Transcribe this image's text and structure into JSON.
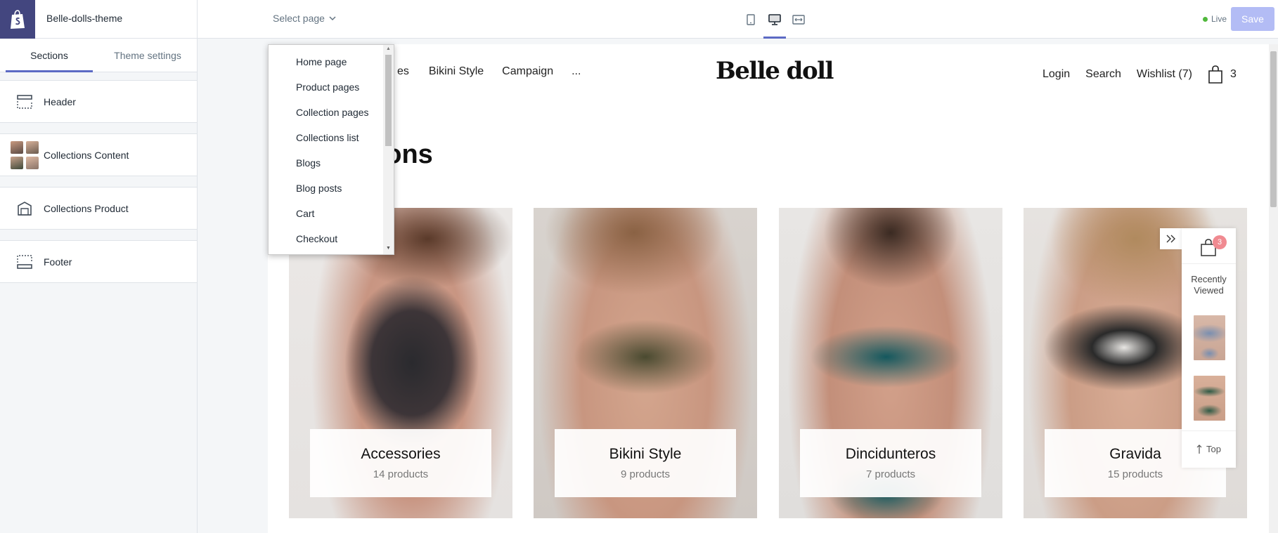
{
  "topbar": {
    "theme_name": "Belle-dolls-theme",
    "select_page_label": "Select page",
    "live_label": "Live",
    "save_label": "Save",
    "devices": [
      "mobile-icon",
      "desktop-icon",
      "full-width-icon"
    ],
    "active_device": "desktop-icon"
  },
  "sidebar": {
    "tabs": [
      {
        "label": "Sections",
        "active": true
      },
      {
        "label": "Theme settings",
        "active": false
      }
    ],
    "sections": [
      {
        "label": "Header",
        "icon": "header-layout-icon"
      },
      {
        "label": "Collections Content",
        "icon": "collection-thumbnails"
      },
      {
        "label": "Collections Product",
        "icon": "product-tag-icon"
      },
      {
        "label": "Footer",
        "icon": "footer-layout-icon"
      }
    ]
  },
  "page_dropdown": {
    "items": [
      "Home page",
      "Product pages",
      "Collection pages",
      "Collections list",
      "Blogs",
      "Blog posts",
      "Cart",
      "Checkout"
    ]
  },
  "store": {
    "nav_partial": "es",
    "nav_links": [
      "Bikini Style",
      "Campaign",
      "..."
    ],
    "brand": "Belle doll",
    "login": "Login",
    "search": "Search",
    "wishlist": "Wishlist (7)",
    "cart_count": "3",
    "heading": "Collections",
    "collections": [
      {
        "title": "Accessories",
        "count": "14 products"
      },
      {
        "title": "Bikini Style",
        "count": "9 products"
      },
      {
        "title": "Dincidunteros",
        "count": "7 products"
      },
      {
        "title": "Gravida",
        "count": "15 products"
      }
    ]
  },
  "widget": {
    "cart_badge": "3",
    "recently_viewed": "Recently Viewed",
    "top_label": "Top"
  },
  "colors": {
    "accent": "#5c6ac4",
    "shopify_dark": "#43467f",
    "save_disabled": "#b3bcf5",
    "live_green": "#50b83c",
    "badge_pink": "#f08a91"
  }
}
